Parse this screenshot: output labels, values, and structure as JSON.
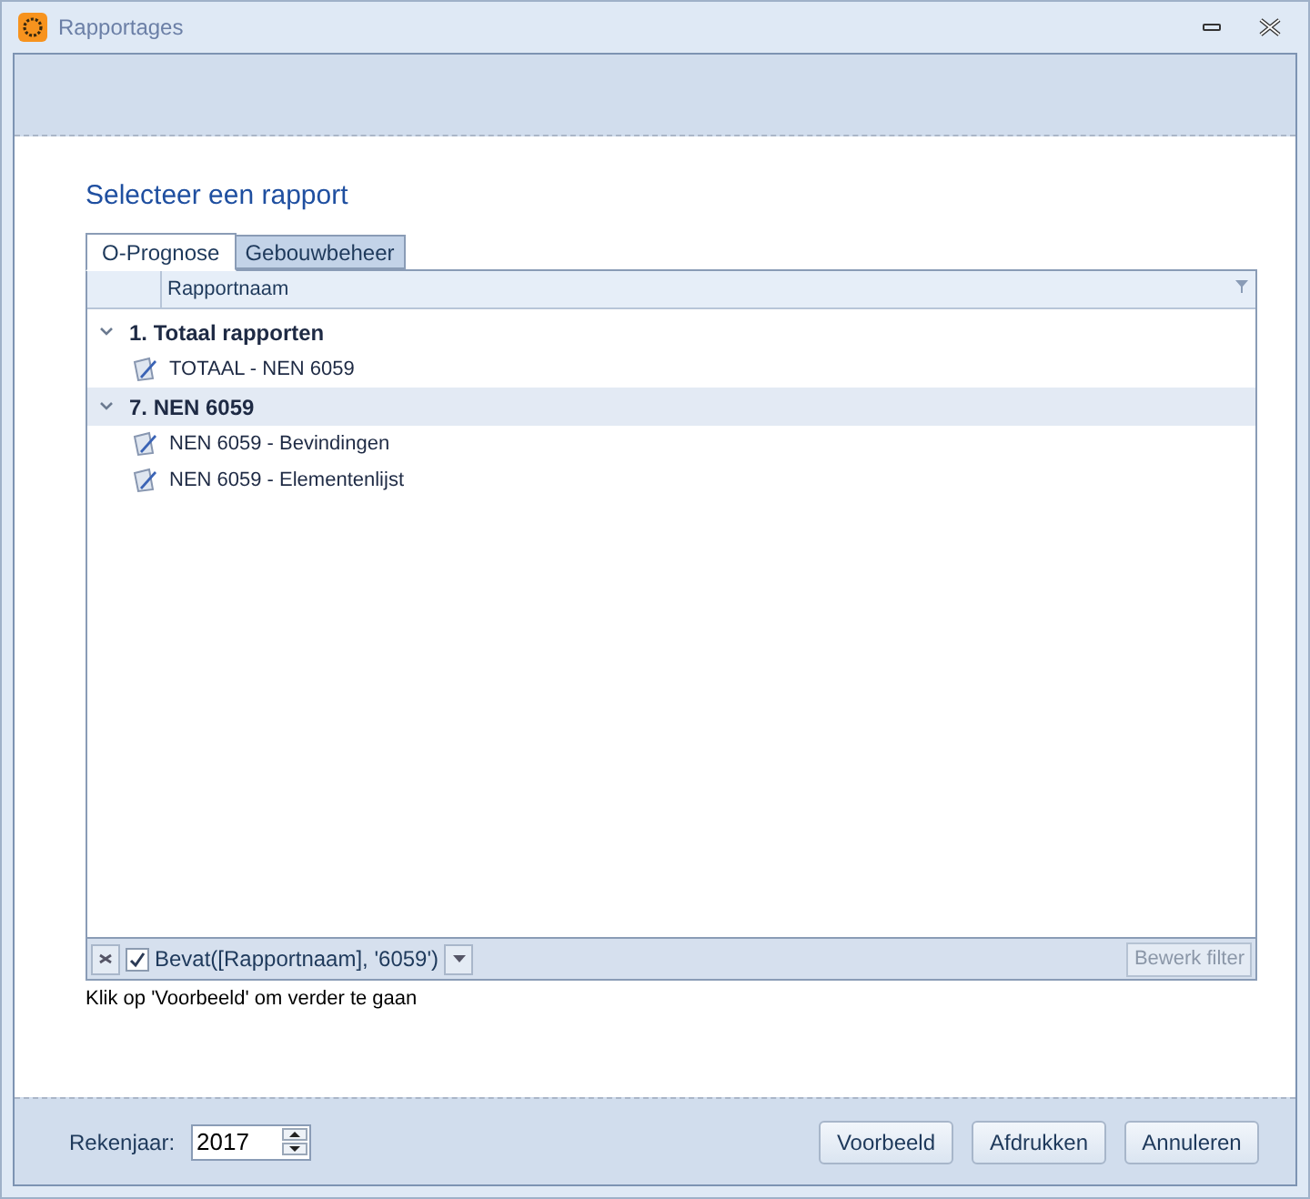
{
  "window": {
    "title": "Rapportages"
  },
  "heading": "Selecteer een rapport",
  "tabs": [
    {
      "label": "O-Prognose",
      "selected": true
    },
    {
      "label": "Gebouwbeheer",
      "selected": false
    }
  ],
  "grid": {
    "column": "Rapportnaam",
    "groups": [
      {
        "label": "1. Totaal rapporten",
        "expanded": true,
        "selected": false,
        "children": [
          {
            "label": "TOTAAL - NEN 6059"
          }
        ]
      },
      {
        "label": "7. NEN 6059",
        "expanded": true,
        "selected": true,
        "children": [
          {
            "label": "NEN 6059 - Bevindingen"
          },
          {
            "label": "NEN 6059 - Elementenlijst"
          }
        ]
      }
    ],
    "filter": {
      "checked": true,
      "expression": "Bevat([Rapportnaam], '6059')",
      "edit_button": "Bewerk filter"
    }
  },
  "hint": "Klik op 'Voorbeeld' om verder te gaan",
  "footer": {
    "year_label": "Rekenjaar:",
    "year_value": "2017",
    "buttons": [
      "Voorbeeld",
      "Afdrukken",
      "Annuleren"
    ]
  }
}
